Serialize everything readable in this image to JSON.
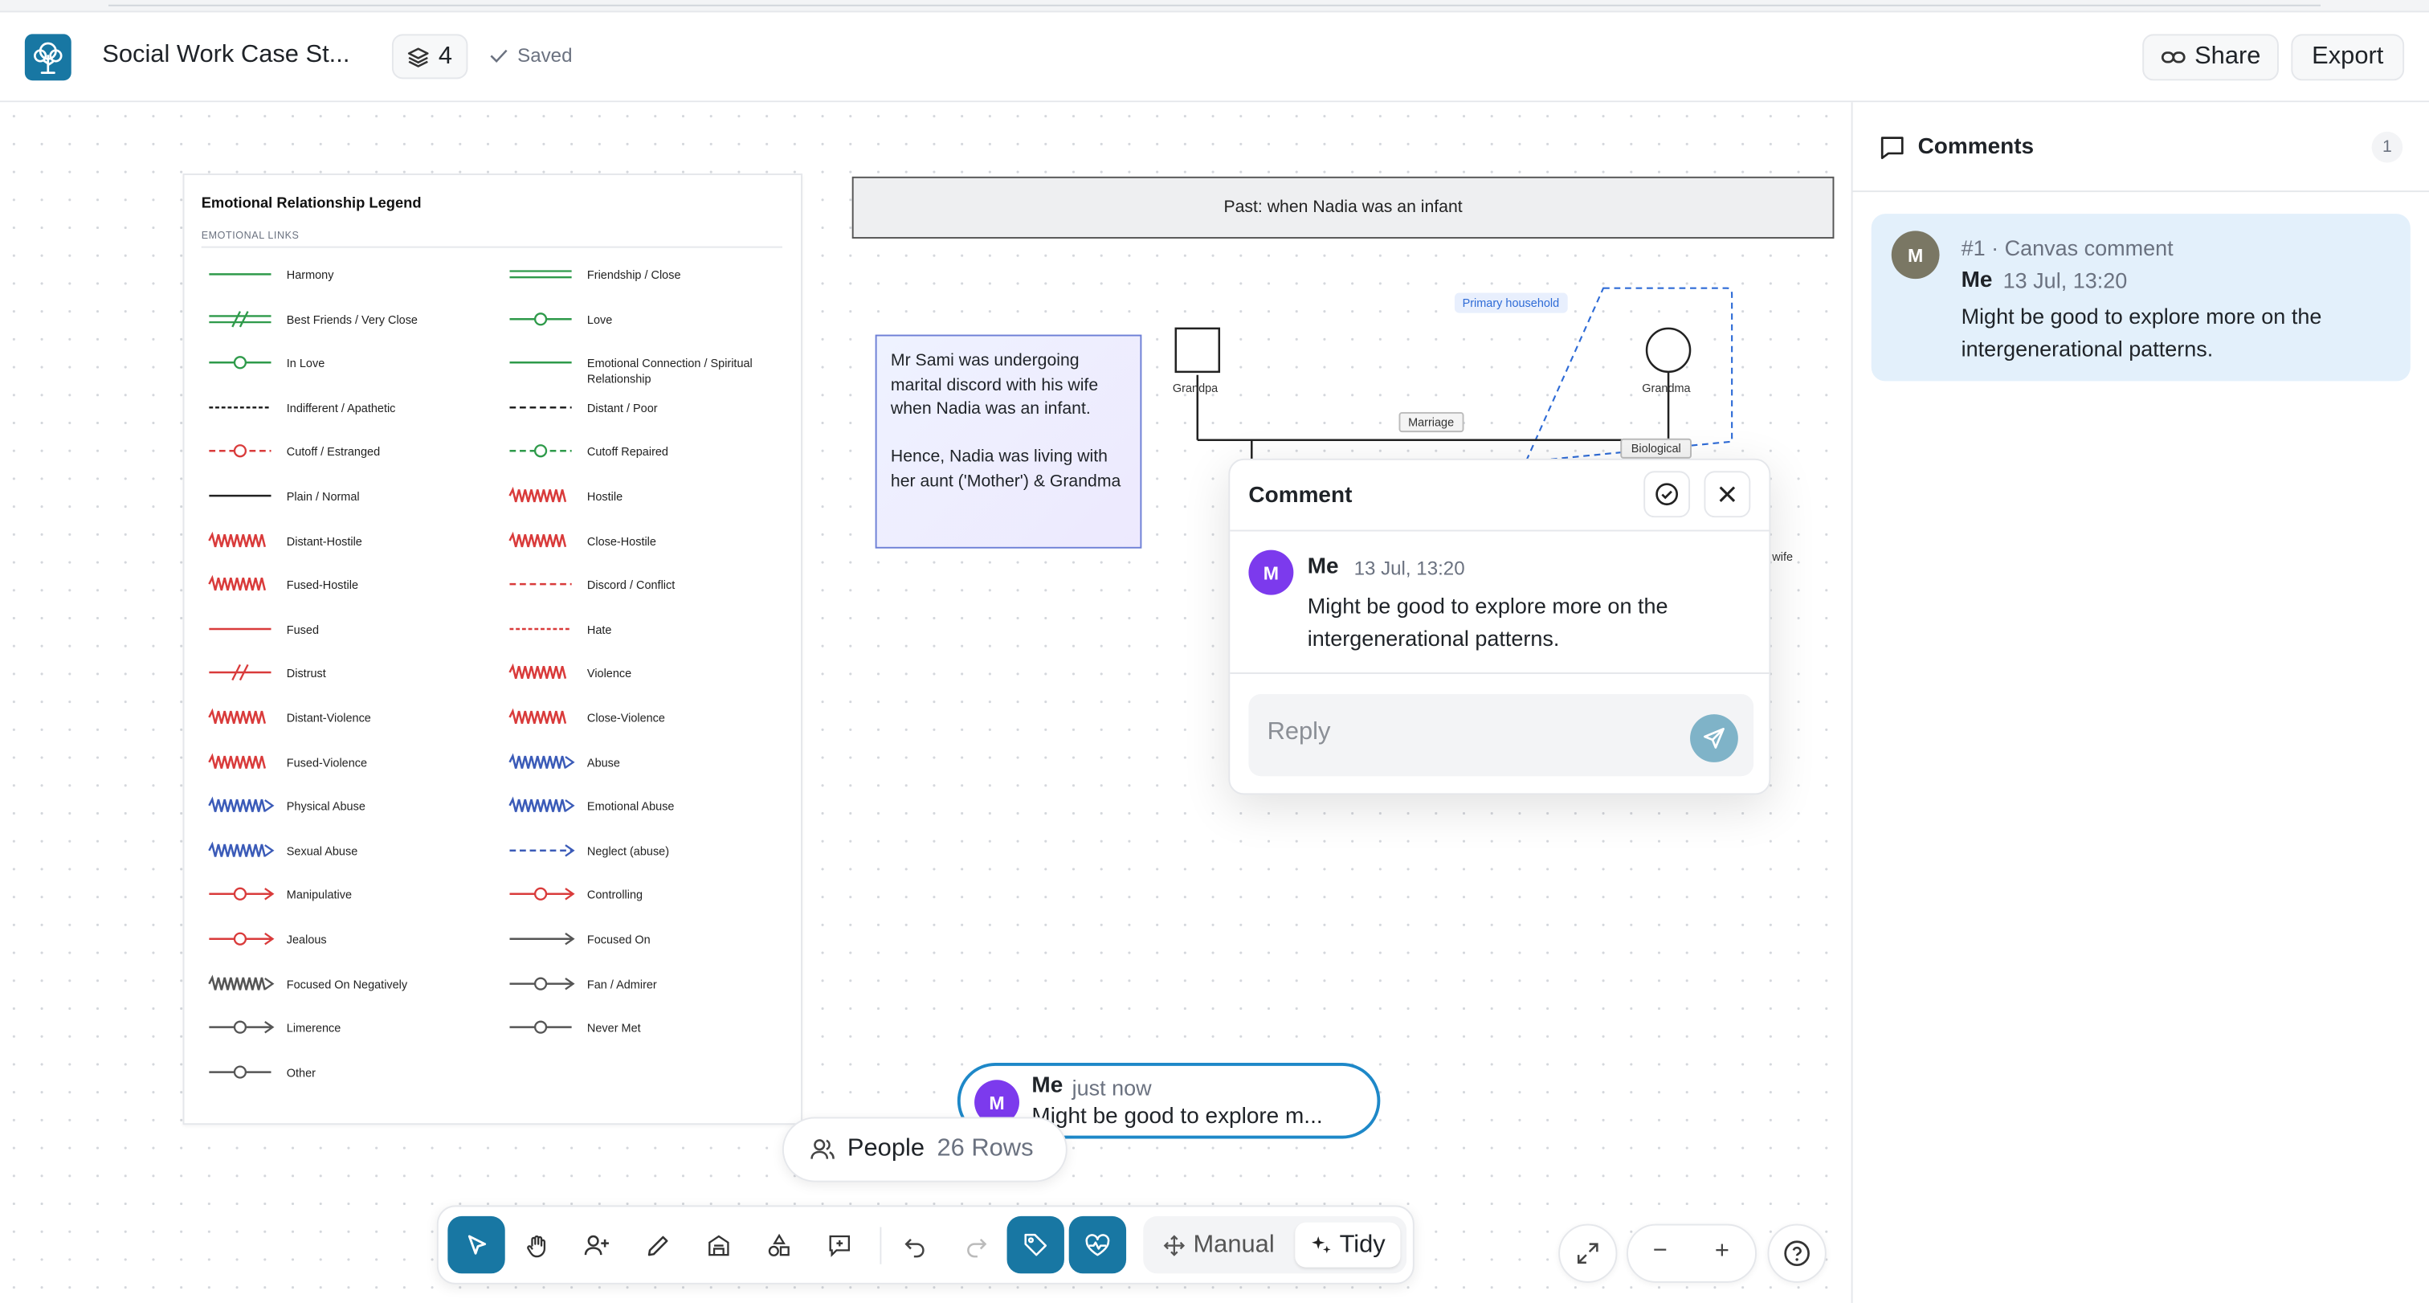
{
  "header": {
    "doc_title": "Social Work Case St...",
    "layers_count": "4",
    "saved_label": "Saved",
    "share_label": "Share",
    "export_label": "Export"
  },
  "comments_panel": {
    "title": "Comments",
    "count": "1",
    "card": {
      "avatar": "M",
      "meta": "#1 · Canvas comment",
      "author": "Me",
      "time": "13 Jul, 13:20",
      "text": "Might be good to explore more on the intergenerational patterns."
    }
  },
  "legend": {
    "title": "Emotional Relationship Legend",
    "subtitle": "EMOTIONAL LINKS",
    "items": [
      {
        "label": "Harmony",
        "style": "solid",
        "color": "#2e9a4a",
        "marker": "none"
      },
      {
        "label": "Friendship / Close",
        "style": "double",
        "color": "#2e9a4a",
        "marker": "none"
      },
      {
        "label": "Best Friends / Very Close",
        "style": "double-slash",
        "color": "#2e9a4a",
        "marker": "slash"
      },
      {
        "label": "Love",
        "style": "solid",
        "color": "#2e9a4a",
        "marker": "circle"
      },
      {
        "label": "In Love",
        "style": "solid",
        "color": "#2e9a4a",
        "marker": "circle"
      },
      {
        "label": "Emotional Connection / Spiritual Relationship",
        "style": "solid",
        "color": "#2e9a4a",
        "marker": "none"
      },
      {
        "label": "Indifferent / Apathetic",
        "style": "dotted",
        "color": "#222222",
        "marker": "none"
      },
      {
        "label": "Distant / Poor",
        "style": "dashed",
        "color": "#222222",
        "marker": "none"
      },
      {
        "label": "Cutoff / Estranged",
        "style": "dashed",
        "color": "#d93b3b",
        "marker": "circle"
      },
      {
        "label": "Cutoff Repaired",
        "style": "dashed",
        "color": "#2e9a4a",
        "marker": "circle"
      },
      {
        "label": "Plain / Normal",
        "style": "solid",
        "color": "#222222",
        "marker": "none"
      },
      {
        "label": "Hostile",
        "style": "zigzag",
        "color": "#d93b3b",
        "marker": "none"
      },
      {
        "label": "Distant-Hostile",
        "style": "zigzag",
        "color": "#d93b3b",
        "marker": "none"
      },
      {
        "label": "Close-Hostile",
        "style": "zigzag",
        "color": "#d93b3b",
        "marker": "none"
      },
      {
        "label": "Fused-Hostile",
        "style": "zigzag",
        "color": "#d93b3b",
        "marker": "none"
      },
      {
        "label": "Discord / Conflict",
        "style": "dashed",
        "color": "#d93b3b",
        "marker": "none"
      },
      {
        "label": "Fused",
        "style": "solid",
        "color": "#d93b3b",
        "marker": "none"
      },
      {
        "label": "Hate",
        "style": "dotted",
        "color": "#d93b3b",
        "marker": "none"
      },
      {
        "label": "Distrust",
        "style": "solid",
        "color": "#d93b3b",
        "marker": "slash"
      },
      {
        "label": "Violence",
        "style": "zigzag",
        "color": "#d93b3b",
        "marker": "none"
      },
      {
        "label": "Distant-Violence",
        "style": "zigzag",
        "color": "#d93b3b",
        "marker": "none"
      },
      {
        "label": "Close-Violence",
        "style": "zigzag",
        "color": "#d93b3b",
        "marker": "none"
      },
      {
        "label": "Fused-Violence",
        "style": "zigzag",
        "color": "#d93b3b",
        "marker": "none"
      },
      {
        "label": "Abuse",
        "style": "zigzag",
        "color": "#3b5bb8",
        "marker": "arrow"
      },
      {
        "label": "Physical Abuse",
        "style": "zigzag",
        "color": "#3b5bb8",
        "marker": "arrow"
      },
      {
        "label": "Emotional Abuse",
        "style": "zigzag",
        "color": "#3b5bb8",
        "marker": "arrow"
      },
      {
        "label": "Sexual Abuse",
        "style": "zigzag",
        "color": "#3b5bb8",
        "marker": "arrow"
      },
      {
        "label": "Neglect (abuse)",
        "style": "dashed",
        "color": "#3b5bb8",
        "marker": "arrow"
      },
      {
        "label": "Manipulative",
        "style": "solid",
        "color": "#d93b3b",
        "marker": "circle-arrow"
      },
      {
        "label": "Controlling",
        "style": "solid",
        "color": "#d93b3b",
        "marker": "circle-arrow"
      },
      {
        "label": "Jealous",
        "style": "solid",
        "color": "#d93b3b",
        "marker": "circle-arrow"
      },
      {
        "label": "Focused On",
        "style": "solid",
        "color": "#555555",
        "marker": "arrow"
      },
      {
        "label": "Focused On Negatively",
        "style": "zigzag",
        "color": "#555555",
        "marker": "arrow"
      },
      {
        "label": "Fan / Admirer",
        "style": "solid",
        "color": "#555555",
        "marker": "circle-arrow"
      },
      {
        "label": "Limerence",
        "style": "solid",
        "color": "#555555",
        "marker": "circle-arrow"
      },
      {
        "label": "Never Met",
        "style": "solid",
        "color": "#555555",
        "marker": "circle"
      },
      {
        "label": "Other",
        "style": "solid",
        "color": "#555555",
        "marker": "circle"
      }
    ]
  },
  "canvas": {
    "banner": "Past: when Nadia was an infant",
    "note_lines": [
      "Mr Sami was undergoing marital discord with his wife when Nadia was an infant.",
      "Hence, Nadia was living with her aunt ('Mother') & Grandma"
    ],
    "genogram": {
      "grandpa": "Grandpa",
      "grandma": "Grandma",
      "marriage": "Marriage",
      "biological": "Biological",
      "household": "Primary household",
      "wife": "wife"
    }
  },
  "comment_popup": {
    "title": "Comment",
    "avatar": "M",
    "author": "Me",
    "time": "13 Jul, 13:20",
    "text": "Might be good to explore more on the intergenerational patterns.",
    "reply_placeholder": "Reply"
  },
  "live_comment": {
    "avatar": "M",
    "author": "Me",
    "time": "just now",
    "text": "Might be good to explore m..."
  },
  "rows_card": {
    "label": "People",
    "count": "26 Rows"
  },
  "toolbar": {
    "manual_label": "Manual",
    "tidy_label": "Tidy"
  },
  "colors": {
    "accent": "#1877a3",
    "comment_card_bg": "#e3f0fb",
    "avatar_purple": "#7c3aed",
    "avatar_grey": "#7a7764"
  }
}
